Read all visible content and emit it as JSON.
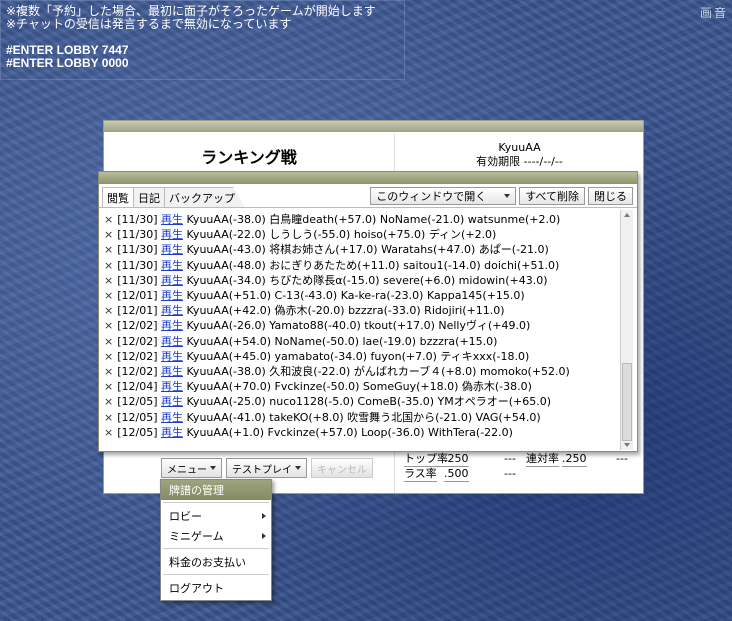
{
  "notice": {
    "line1": "※複数「予約」した場合、最初に面子がそろったゲームが開始します",
    "line2": "※チャットの受信は発言するまで無効になっています",
    "line3": "#ENTER LOBBY 7447",
    "line4": "#ENTER LOBBY 0000"
  },
  "corner_text": "画音",
  "ranking": {
    "title": "ランキング戦",
    "user": "KyuuAA",
    "expiry": "有効期限 ----/--/--",
    "stats": {
      "row1_label": "トップ率",
      "row1_value": ".250",
      "row1_dash": "---",
      "row1b_label": "連対率",
      "row1b_value": ".250",
      "row1b_dash": "---",
      "row2_label": "ラス率",
      "row2_value": ".500",
      "row2_dash": "---"
    },
    "menu_button": "メニュー",
    "test_play_button": "テストプレイ",
    "cancel_button": "キャンセル"
  },
  "diary": {
    "tabs": [
      "閲覧",
      "日記",
      "バックアップ"
    ],
    "window_select": "このウィンドウで開く",
    "delete_all": "すべて削除",
    "close": "閉じる",
    "close_mark": "×",
    "play_label": "再生",
    "entries": [
      {
        "date": "[11/30]",
        "text": "KyuuAA(-38.0) 白鳥瞳death(+57.0) NoName(-21.0) watsunme(+2.0)"
      },
      {
        "date": "[11/30]",
        "text": "KyuuAA(-22.0) しうしう(-55.0) hoiso(+75.0) ディン(+2.0)"
      },
      {
        "date": "[11/30]",
        "text": "KyuuAA(-43.0) 将棋お姉さん(+17.0) Waratahs(+47.0) あぱー(-21.0)"
      },
      {
        "date": "[11/30]",
        "text": "KyuuAA(-48.0) おにぎりあたため(+11.0) saitou1(-14.0) doichi(+51.0)"
      },
      {
        "date": "[11/30]",
        "text": "KyuuAA(-34.0) ちびため隊長α(-15.0) severe(+6.0) midowin(+43.0)"
      },
      {
        "date": "[12/01]",
        "text": "KyuuAA(+51.0) C-13(-43.0) Ka-ke-ra(-23.0) Kappa145(+15.0)"
      },
      {
        "date": "[12/01]",
        "text": "KyuuAA(+42.0) 偽赤木(-20.0) bzzzra(-33.0) Ridojiri(+11.0)"
      },
      {
        "date": "[12/02]",
        "text": "KyuuAA(-26.0) Yamato88(-40.0) tkout(+17.0) Nellyヴィ(+49.0)"
      },
      {
        "date": "[12/02]",
        "text": "KyuuAA(+54.0) NoName(-50.0) lae(-19.0) bzzzra(+15.0)"
      },
      {
        "date": "[12/02]",
        "text": "KyuuAA(+45.0) yamabato(-34.0) fuyon(+7.0) ティキxxx(-18.0)"
      },
      {
        "date": "[12/02]",
        "text": "KyuuAA(-38.0) 久和波良(-22.0) がんばれカーブ４(+8.0) momoko(+52.0)"
      },
      {
        "date": "[12/04]",
        "text": "KyuuAA(+70.0) Fvckinze(-50.0) SomeGuy(+18.0) 偽赤木(-38.0)"
      },
      {
        "date": "[12/05]",
        "text": "KyuuAA(-25.0) nuco1128(-5.0) ComeB(-35.0) YMオペラオー(+65.0)"
      },
      {
        "date": "[12/05]",
        "text": "KyuuAA(-41.0) takeKO(+8.0) 吹雪舞う北国から(-21.0) VAG(+54.0)"
      },
      {
        "date": "[12/05]",
        "text": "KyuuAA(+1.0) Fvckinze(+57.0) Loop(-36.0) WithTera(-22.0)"
      }
    ]
  },
  "menu": {
    "items": [
      "牌譜の管理",
      "ロビー",
      "ミニゲーム",
      "料金のお支払い",
      "ログアウト"
    ]
  }
}
